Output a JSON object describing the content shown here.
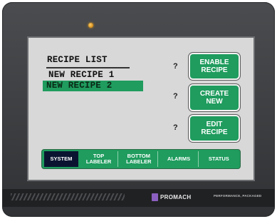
{
  "recipe_panel": {
    "heading": "RECIPE LIST",
    "items": [
      "NEW RECIPE 1",
      "NEW RECIPE 2"
    ],
    "selected_index": 1
  },
  "actions": [
    {
      "help": "?",
      "line1": "ENABLE",
      "line2": "RECIPE"
    },
    {
      "help": "?",
      "line1": "CREATE",
      "line2": "NEW"
    },
    {
      "help": "?",
      "line1": "EDIT",
      "line2": "RECIPE"
    }
  ],
  "tabs": [
    {
      "line1": "SYSTEM",
      "line2": "",
      "active": true
    },
    {
      "line1": "TOP",
      "line2": "LABELER",
      "active": false
    },
    {
      "line1": "BOTTOM",
      "line2": "LABELER",
      "active": false
    },
    {
      "line1": "ALARMS",
      "line2": "",
      "active": false
    },
    {
      "line1": "STATUS",
      "line2": "",
      "active": false
    }
  ],
  "footer": {
    "brand": "PROMACH",
    "tagline": "PERFORMANCE, PACKAGED"
  },
  "colors": {
    "accent_green": "#1f9c5e",
    "active_tab": "#0a1430",
    "screen_bg": "#d8d8d8",
    "bezel": "#3c3e41",
    "brand_purple": "#8b5fbf"
  }
}
